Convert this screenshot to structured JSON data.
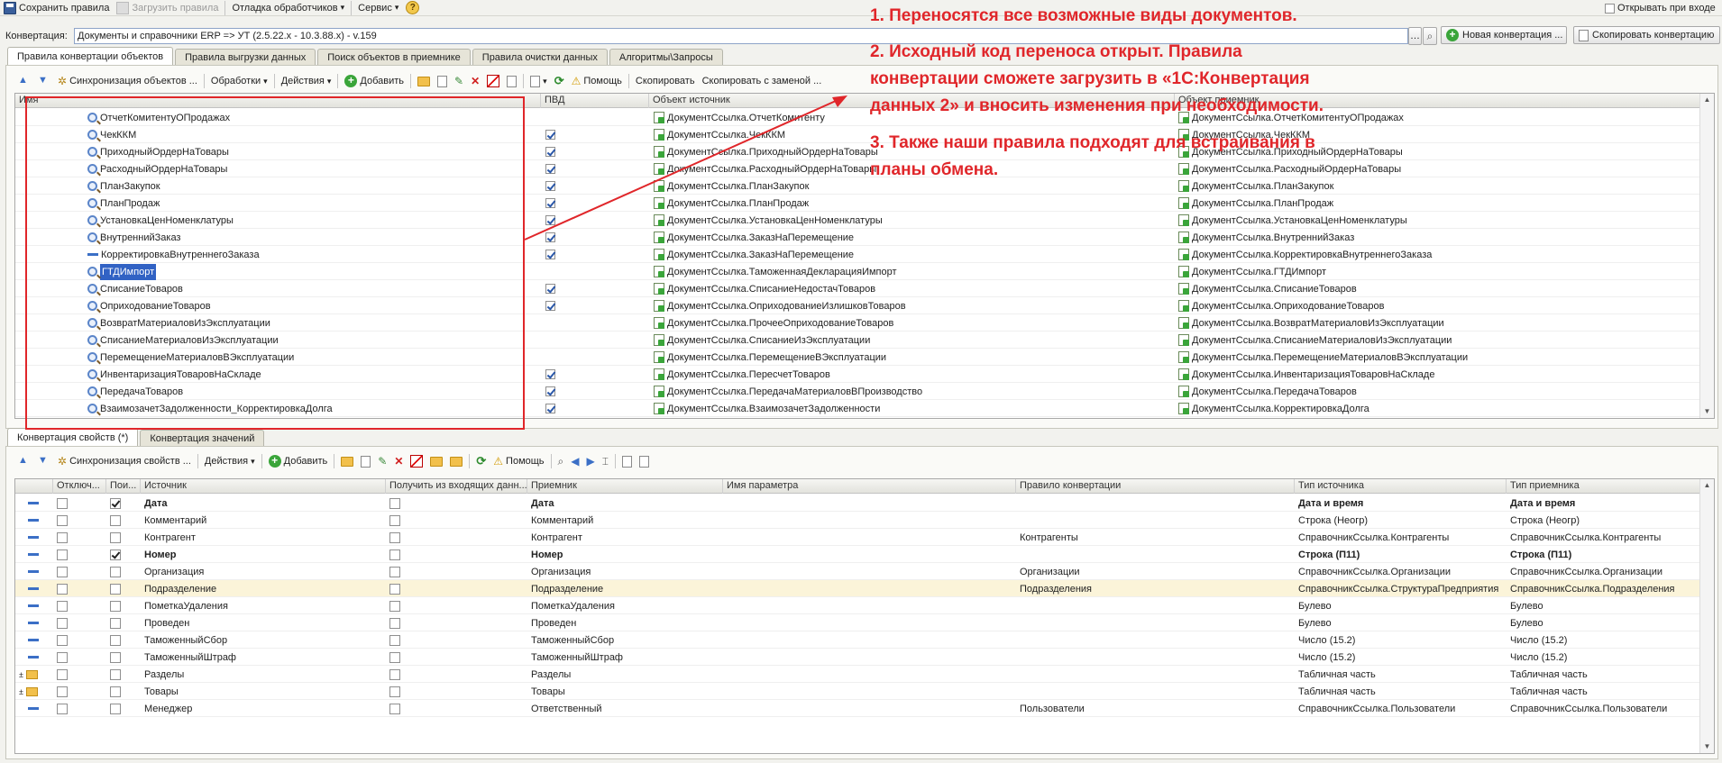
{
  "menu": {
    "save_rules": "Сохранить правила",
    "load_rules": "Загрузить правила",
    "debug_handlers": "Отладка обработчиков",
    "service": "Сервис",
    "open_on_login": "Открывать при входе"
  },
  "conversion": {
    "label": "Конвертация:",
    "value": "Документы и справочники ERP => УТ (2.5.22.x - 10.3.88.x) - v.159",
    "new_button": "Новая конвертация ...",
    "copy_button": "Скопировать конвертацию"
  },
  "top_tabs": [
    "Правила конвертации объектов",
    "Правила выгрузки данных",
    "Поиск объектов в приемнике",
    "Правила очистки данных",
    "Алгоритмы\\Запросы"
  ],
  "top_toolbar": {
    "sync": "Синхронизация объектов ...",
    "processing": "Обработки",
    "actions": "Действия",
    "add": "Добавить",
    "help": "Помощь",
    "copy": "Скопировать",
    "copy_replace": "Скопировать с заменой ..."
  },
  "objects_table": {
    "headers": {
      "name": "Имя",
      "pvd": "ПВД",
      "source": "Объект источник",
      "target": "Объект приемник"
    },
    "rows": [
      {
        "name": "ОтчетКомитентуОПродажах",
        "icon": "magnifier-icon",
        "pvd": false,
        "source": "ДокументСсылка.ОтчетКомитенту",
        "target": "ДокументСсылка.ОтчетКомитентуОПродажах"
      },
      {
        "name": "ЧекККМ",
        "icon": "magnifier-icon",
        "pvd": true,
        "source": "ДокументСсылка.ЧекККМ",
        "target": "ДокументСсылка.ЧекККМ"
      },
      {
        "name": "ПриходныйОрдерНаТовары",
        "icon": "magnifier-icon",
        "pvd": true,
        "source": "ДокументСсылка.ПриходныйОрдерНаТовары",
        "target": "ДокументСсылка.ПриходныйОрдерНаТовары"
      },
      {
        "name": "РасходныйОрдерНаТовары",
        "icon": "magnifier-icon",
        "pvd": true,
        "source": "ДокументСсылка.РасходныйОрдерНаТовары",
        "target": "ДокументСсылка.РасходныйОрдерНаТовары"
      },
      {
        "name": "ПланЗакупок",
        "icon": "magnifier-icon",
        "pvd": true,
        "source": "ДокументСсылка.ПланЗакупок",
        "target": "ДокументСсылка.ПланЗакупок"
      },
      {
        "name": "ПланПродаж",
        "icon": "magnifier-icon",
        "pvd": true,
        "source": "ДокументСсылка.ПланПродаж",
        "target": "ДокументСсылка.ПланПродаж"
      },
      {
        "name": "УстановкаЦенНоменклатуры",
        "icon": "magnifier-icon",
        "pvd": true,
        "source": "ДокументСсылка.УстановкаЦенНоменклатуры",
        "target": "ДокументСсылка.УстановкаЦенНоменклатуры"
      },
      {
        "name": "ВнутреннийЗаказ",
        "icon": "magnifier-icon",
        "pvd": true,
        "source": "ДокументСсылка.ЗаказНаПеремещение",
        "target": "ДокументСсылка.ВнутреннийЗаказ"
      },
      {
        "name": "КорректировкаВнутреннегоЗаказа",
        "icon": "dash-icon",
        "pvd": true,
        "source": "ДокументСсылка.ЗаказНаПеремещение",
        "target": "ДокументСсылка.КорректировкаВнутреннегоЗаказа"
      },
      {
        "name": "ГТДИмпорт",
        "icon": "magnifier-icon",
        "pvd": false,
        "selected": true,
        "source": "ДокументСсылка.ТаможеннаяДекларацияИмпорт",
        "target": "ДокументСсылка.ГТДИмпорт"
      },
      {
        "name": "СписаниеТоваров",
        "icon": "magnifier-icon",
        "pvd": true,
        "source": "ДокументСсылка.СписаниеНедостачТоваров",
        "target": "ДокументСсылка.СписаниеТоваров"
      },
      {
        "name": "ОприходованиеТоваров",
        "icon": "magnifier-icon",
        "pvd": true,
        "source": "ДокументСсылка.ОприходованиеИзлишковТоваров",
        "target": "ДокументСсылка.ОприходованиеТоваров"
      },
      {
        "name": "ВозвратМатериаловИзЭксплуатации",
        "icon": "magnifier-icon",
        "pvd": false,
        "source": "ДокументСсылка.ПрочееОприходованиеТоваров",
        "target": "ДокументСсылка.ВозвратМатериаловИзЭксплуатации"
      },
      {
        "name": "СписаниеМатериаловИзЭксплуатации",
        "icon": "magnifier-icon",
        "pvd": false,
        "source": "ДокументСсылка.СписаниеИзЭксплуатации",
        "target": "ДокументСсылка.СписаниеМатериаловИзЭксплуатации"
      },
      {
        "name": "ПеремещениеМатериаловВЭксплуатации",
        "icon": "magnifier-icon",
        "pvd": false,
        "source": "ДокументСсылка.ПеремещениеВЭксплуатации",
        "target": "ДокументСсылка.ПеремещениеМатериаловВЭксплуатации"
      },
      {
        "name": "ИнвентаризацияТоваровНаСкладе",
        "icon": "magnifier-icon",
        "pvd": true,
        "source": "ДокументСсылка.ПересчетТоваров",
        "target": "ДокументСсылка.ИнвентаризацияТоваровНаСкладе"
      },
      {
        "name": "ПередачаТоваров",
        "icon": "magnifier-icon",
        "pvd": true,
        "source": "ДокументСсылка.ПередачаМатериаловВПроизводство",
        "target": "ДокументСсылка.ПередачаТоваров"
      },
      {
        "name": "ВзаимозачетЗадолженности_КорректировкаДолга",
        "icon": "magnifier-icon",
        "pvd": true,
        "source": "ДокументСсылка.ВзаимозачетЗадолженности",
        "target": "ДокументСсылка.КорректировкаДолга"
      }
    ]
  },
  "annotations": [
    "1. Переносятся все возможные виды документов.",
    "2. Исходный код переноса открыт. Правила",
    "конвертации сможете загрузить в «1С:Конвертация",
    "данных 2» и вносить изменения при необходимости.",
    "3. Также наши правила подходят для встраивания в",
    "планы обмена."
  ],
  "bottom_tabs": [
    "Конвертация свойств (*)",
    "Конвертация значений"
  ],
  "bottom_toolbar": {
    "sync": "Синхронизация свойств ...",
    "actions": "Действия",
    "add": "Добавить",
    "help": "Помощь"
  },
  "props_table": {
    "headers": {
      "disabled": "Отключ...",
      "search": "Пои...",
      "source": "Источник",
      "incoming": "Получить из входящих данн...",
      "target": "Приемник",
      "param": "Имя параметра",
      "rule": "Правило конвертации",
      "src_type": "Тип источника",
      "dst_type": "Тип приемника"
    },
    "rows": [
      {
        "kind": "prop",
        "search": true,
        "bold": true,
        "source": "Дата",
        "target": "Дата",
        "rule": "",
        "src_type": "Дата и время",
        "dst_type": "Дата и время"
      },
      {
        "kind": "prop",
        "search": false,
        "bold": false,
        "source": "Комментарий",
        "target": "Комментарий",
        "rule": "",
        "src_type": "Строка (Неогр)",
        "dst_type": "Строка (Неогр)"
      },
      {
        "kind": "prop",
        "search": false,
        "bold": false,
        "source": "Контрагент",
        "target": "Контрагент",
        "rule": "Контрагенты",
        "src_type": "СправочникСсылка.Контрагенты",
        "dst_type": "СправочникСсылка.Контрагенты"
      },
      {
        "kind": "prop",
        "search": true,
        "bold": true,
        "source": "Номер",
        "target": "Номер",
        "rule": "",
        "src_type": "Строка (П11)",
        "dst_type": "Строка (П11)"
      },
      {
        "kind": "prop",
        "search": false,
        "bold": false,
        "source": "Организация",
        "target": "Организация",
        "rule": "Организации",
        "src_type": "СправочникСсылка.Организации",
        "dst_type": "СправочникСсылка.Организации"
      },
      {
        "kind": "prop",
        "search": false,
        "bold": false,
        "highlight": true,
        "source": "Подразделение",
        "target": "Подразделение",
        "rule": "Подразделения",
        "src_type": "СправочникСсылка.СтруктураПредприятия",
        "dst_type": "СправочникСсылка.Подразделения"
      },
      {
        "kind": "prop",
        "search": false,
        "bold": false,
        "source": "ПометкаУдаления",
        "target": "ПометкаУдаления",
        "rule": "",
        "src_type": "Булево",
        "dst_type": "Булево"
      },
      {
        "kind": "prop",
        "search": false,
        "bold": false,
        "source": "Проведен",
        "target": "Проведен",
        "rule": "",
        "src_type": "Булево",
        "dst_type": "Булево"
      },
      {
        "kind": "prop",
        "search": false,
        "bold": false,
        "source": "ТаможенныйСбор",
        "target": "ТаможенныйСбор",
        "rule": "",
        "src_type": "Число (15.2)",
        "dst_type": "Число (15.2)"
      },
      {
        "kind": "prop",
        "search": false,
        "bold": false,
        "source": "ТаможенныйШтраф",
        "target": "ТаможенныйШтраф",
        "rule": "",
        "src_type": "Число (15.2)",
        "dst_type": "Число (15.2)"
      },
      {
        "kind": "group",
        "search": false,
        "bold": false,
        "source": "Разделы",
        "target": "Разделы",
        "rule": "",
        "src_type": "Табличная часть",
        "dst_type": "Табличная часть"
      },
      {
        "kind": "group",
        "search": false,
        "bold": false,
        "source": "Товары",
        "target": "Товары",
        "rule": "",
        "src_type": "Табличная часть",
        "dst_type": "Табличная часть"
      },
      {
        "kind": "prop",
        "search": false,
        "bold": false,
        "source": "Менеджер",
        "target": "Ответственный",
        "rule": "Пользователи",
        "src_type": "СправочникСсылка.Пользователи",
        "dst_type": "СправочникСсылка.Пользователи"
      }
    ]
  },
  "colors": {
    "annotation": "#e0262a",
    "selection": "#3162c4",
    "frame": "#e0262a"
  }
}
